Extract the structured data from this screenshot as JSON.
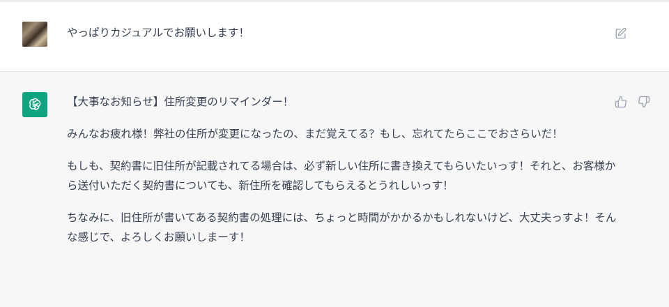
{
  "user_message": {
    "text": "やっぱりカジュアルでお願いします！",
    "avatar_icon": "user-avatar-photo",
    "edit_icon": "pencil-square-icon"
  },
  "assistant_message": {
    "avatar_icon": "openai-logo-icon",
    "accent_color": "#10a37f",
    "paragraphs": [
      "【大事なお知らせ】住所変更のリマインダー！",
      "みんなお疲れ様！弊社の住所が変更になったの、まだ覚えてる？もし、忘れてたらここでおさらいだ！",
      "もしも、契約書に旧住所が記載されてる場合は、必ず新しい住所に書き換えてもらいたいっす！それと、お客様から送付いただく契約書についても、新住所を確認してもらえるとうれしいっす！",
      "ちなみに、旧住所が書いてある契約書の処理には、ちょっと時間がかかるかもしれないけど、大丈夫っすよ！そんな感じで、よろしくお願いしまーす！"
    ],
    "feedback_icons": [
      "thumbs-up-icon",
      "thumbs-down-icon"
    ]
  }
}
